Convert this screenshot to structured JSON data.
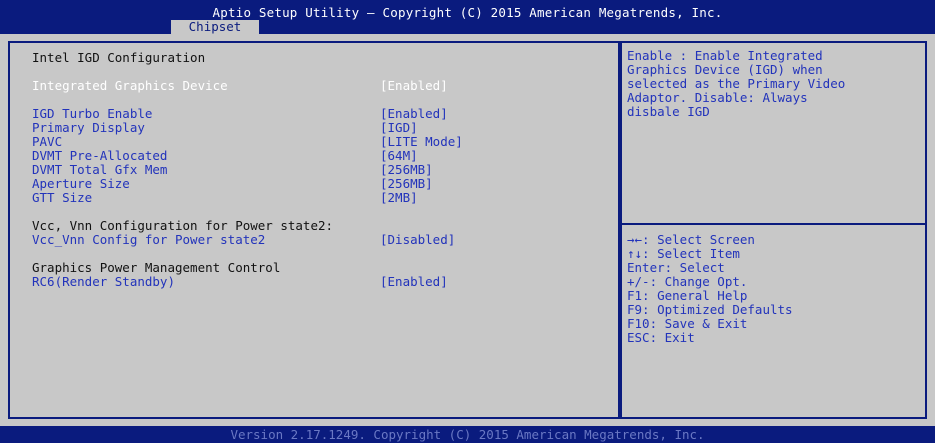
{
  "header": {
    "title": "Aptio Setup Utility – Copyright (C) 2015 American Megatrends, Inc.",
    "active_tab": "Chipset"
  },
  "main": {
    "section_title": "Intel IGD Configuration",
    "selected_item": {
      "label": "Integrated Graphics Device",
      "value": "[Enabled]"
    },
    "settings": [
      {
        "label": "IGD Turbo Enable",
        "value": "[Enabled]"
      },
      {
        "label": "Primary Display",
        "value": "[IGD]"
      },
      {
        "label": "PAVC",
        "value": "[LITE Mode]"
      },
      {
        "label": "DVMT Pre-Allocated",
        "value": "[64M]"
      },
      {
        "label": "DVMT Total Gfx Mem",
        "value": "[256MB]"
      },
      {
        "label": "Aperture Size",
        "value": "[256MB]"
      },
      {
        "label": "GTT Size",
        "value": "[2MB]"
      }
    ],
    "vcc_heading": "Vcc, Vnn Configuration for Power state2:",
    "vcc_item": {
      "label": "Vcc_Vnn Config for Power state2",
      "value": "[Disabled]"
    },
    "gpm_heading": "Graphics Power Management Control",
    "rc6_item": {
      "label": "RC6(Render Standby)",
      "value": "[Enabled]"
    }
  },
  "help": {
    "description": "Enable : Enable Integrated\nGraphics Device (IGD) when\nselected as the Primary Video\nAdaptor. Disable: Always\ndisbale IGD",
    "keys": [
      "→←: Select Screen",
      "↑↓: Select Item",
      "Enter: Select",
      "+/-: Change Opt.",
      "F1: General Help",
      "F9: Optimized Defaults",
      "F10: Save & Exit",
      "ESC: Exit"
    ]
  },
  "footer": {
    "text": "Version 2.17.1249. Copyright (C) 2015 American Megatrends, Inc."
  },
  "colors": {
    "background_blue": "#0a1b7e",
    "panel_gray": "#c8c8c8",
    "item_blue": "#2233bb",
    "selected_white": "#ffffff"
  }
}
